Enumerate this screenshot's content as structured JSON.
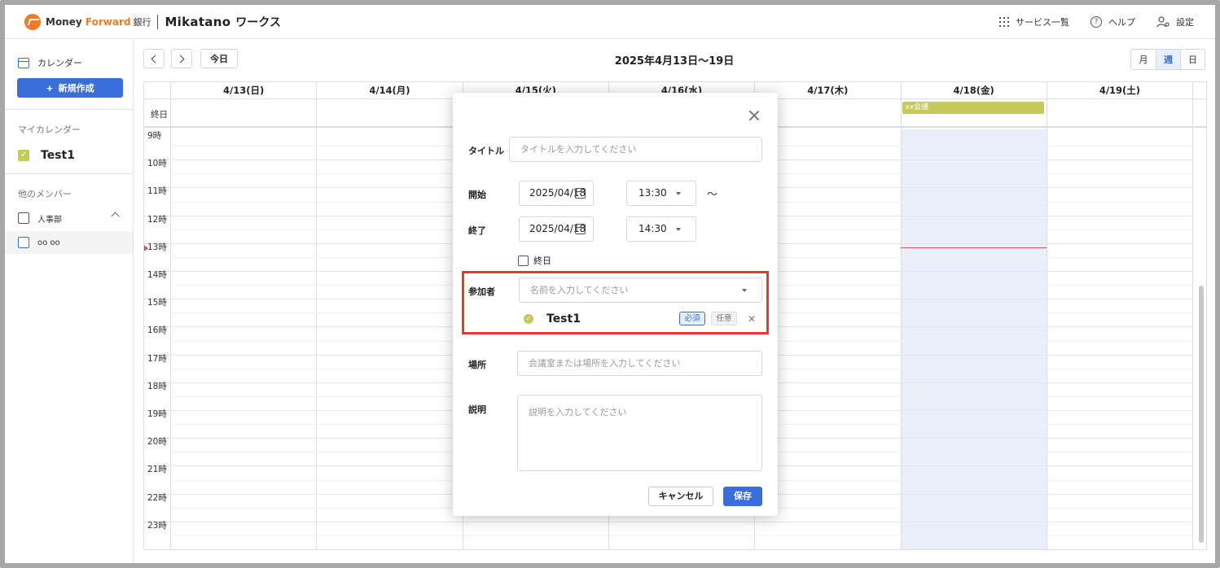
{
  "header": {
    "brand_money": "Money ",
    "brand_forward": "Forward",
    "brand_bank": "銀行",
    "brand_mikatano": "Mikatano",
    "brand_works": "ワークス",
    "services_label": "サービス一覧",
    "help_label": "ヘルプ",
    "settings_label": "設定"
  },
  "sidebar": {
    "calendar_label": "カレンダー",
    "new_button": "新規作成",
    "my_calendar_heading": "マイカレンダー",
    "my_calendar_item": "Test1",
    "other_members_heading": "他のメンバー",
    "group_label": "人事部",
    "member_label": "oo oo"
  },
  "toolbar": {
    "today": "今日",
    "range_title": "2025年4月13日〜19日",
    "views": [
      "月",
      "週",
      "日"
    ],
    "active_view": "週"
  },
  "calendar": {
    "days": [
      "4/13(日)",
      "4/14(月)",
      "4/15(火)",
      "4/16(水)",
      "4/17(木)",
      "4/18(金)",
      "4/19(土)"
    ],
    "highlighted_day": "4/18(金)",
    "allday_label": "終日",
    "hours": [
      "9時",
      "10時",
      "11時",
      "12時",
      "13時",
      "14時",
      "15時",
      "16時",
      "17時",
      "18時",
      "19時",
      "20時",
      "21時",
      "22時",
      "23時"
    ],
    "current_hour": "13時",
    "events": [
      {
        "title": "xx会議",
        "day": "4/18(金)",
        "all_day": true,
        "color": "#c5c95a"
      }
    ]
  },
  "modal": {
    "title_label": "タイトル",
    "title_placeholder": "タイトルを入力してください",
    "start_label": "開始",
    "start_date": "2025/04/18",
    "start_time": "13:30",
    "tilde": "〜",
    "end_label": "終了",
    "end_date": "2025/04/18",
    "end_time": "14:30",
    "allday_label": "終日",
    "participants_label": "参加者",
    "participants_placeholder": "名前を入力してください",
    "participant_name": "Test1",
    "required_badge": "必須",
    "optional_badge": "任意",
    "location_label": "場所",
    "location_placeholder": "会議室または場所を入力してください",
    "description_label": "説明",
    "description_placeholder": "説明を入力してください",
    "cancel_button": "キャンセル",
    "save_button": "保存"
  },
  "colors": {
    "accent": "#3b6fd8",
    "event": "#c5c95a",
    "highlight_border": "#e33b2e",
    "now_line": "#d9534f"
  }
}
